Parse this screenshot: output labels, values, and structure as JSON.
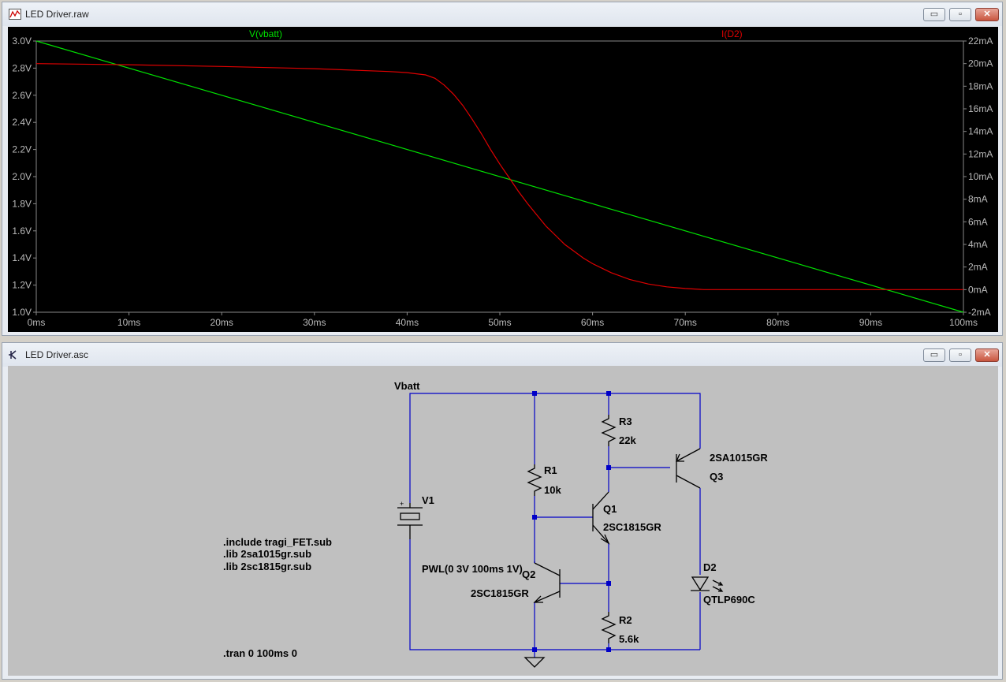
{
  "plot_window": {
    "title": "LED Driver.raw",
    "icon": "waveform-icon",
    "controls": {
      "minimize": "▭",
      "restore": "▫",
      "close": "✕"
    }
  },
  "schematic_window": {
    "title": "LED Driver.asc",
    "icon": "schematic-icon",
    "controls": {
      "minimize": "▭",
      "restore": "▫",
      "close": "✕"
    }
  },
  "chart_data": {
    "type": "line",
    "xlabel": "",
    "x_ticks": [
      "0ms",
      "10ms",
      "20ms",
      "30ms",
      "40ms",
      "50ms",
      "60ms",
      "70ms",
      "80ms",
      "90ms",
      "100ms"
    ],
    "xlim": [
      0,
      100
    ],
    "y_left_ticks": [
      "3.0V",
      "2.8V",
      "2.6V",
      "2.4V",
      "2.2V",
      "2.0V",
      "1.8V",
      "1.6V",
      "1.4V",
      "1.2V",
      "1.0V"
    ],
    "ylim_left": [
      1.0,
      3.0
    ],
    "y_right_ticks": [
      "22mA",
      "20mA",
      "18mA",
      "16mA",
      "14mA",
      "12mA",
      "10mA",
      "8mA",
      "6mA",
      "4mA",
      "2mA",
      "0mA",
      "-2mA"
    ],
    "ylim_right": [
      -2,
      22
    ],
    "grid": false,
    "series": [
      {
        "name": "V(vbatt)",
        "axis": "left",
        "color": "#00e000",
        "x": [
          0,
          100
        ],
        "y": [
          3.0,
          1.0
        ]
      },
      {
        "name": "I(D2)",
        "axis": "right",
        "color": "#e00000",
        "x": [
          0,
          10,
          20,
          30,
          38,
          40,
          41,
          42,
          43,
          44,
          45,
          46,
          47,
          48,
          49,
          50,
          51,
          52,
          53,
          54,
          55,
          56,
          57,
          58,
          59,
          60,
          62,
          64,
          66,
          68,
          70,
          72,
          80,
          90,
          100
        ],
        "y": [
          20.0,
          19.9,
          19.75,
          19.55,
          19.3,
          19.2,
          19.1,
          19.0,
          18.7,
          18.1,
          17.3,
          16.3,
          15.1,
          13.8,
          12.4,
          11.1,
          9.9,
          8.7,
          7.6,
          6.6,
          5.6,
          4.8,
          4.0,
          3.4,
          2.8,
          2.3,
          1.5,
          0.9,
          0.5,
          0.25,
          0.1,
          0.0,
          0.0,
          0.0,
          0.0
        ]
      }
    ]
  },
  "schematic": {
    "net_vbatt": "Vbatt",
    "source": {
      "name": "V1",
      "value": "PWL(0 3V 100ms 1V)",
      "plus": "+"
    },
    "r1": {
      "name": "R1",
      "value": "10k"
    },
    "r2": {
      "name": "R2",
      "value": "5.6k"
    },
    "r3": {
      "name": "R3",
      "value": "22k"
    },
    "q1": {
      "name": "Q1",
      "model": "2SC1815GR"
    },
    "q2": {
      "name": "Q2",
      "model": "2SC1815GR"
    },
    "q3": {
      "name": "Q3",
      "model": "2SA1015GR"
    },
    "d2": {
      "name": "D2",
      "model": "QTLP690C"
    },
    "directives": [
      ".include tragi_FET.sub",
      ".lib 2sa1015gr.sub",
      ".lib 2sc1815gr.sub"
    ],
    "tran": ".tran 0 100ms 0",
    "wire_color": "#0000c8",
    "component_color": "#000000"
  }
}
